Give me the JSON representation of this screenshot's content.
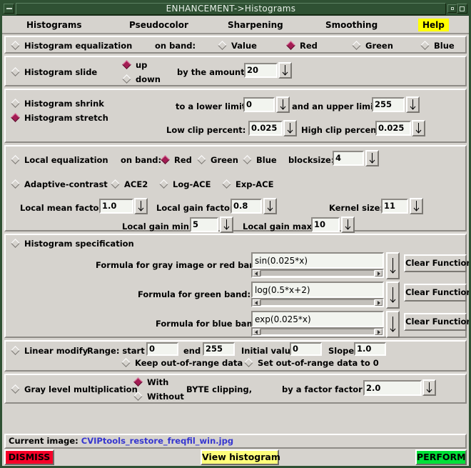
{
  "window": {
    "title": "ENHANCEMENT->Histograms",
    "minimize_icon": "minimize-icon",
    "restore_icon": "restore-icon",
    "maximize_icon": "maximize-icon"
  },
  "menubar": {
    "items": [
      {
        "label": "Histograms"
      },
      {
        "label": "Pseudocolor"
      },
      {
        "label": "Sharpening"
      },
      {
        "label": "Smoothing"
      },
      {
        "label": "Help"
      }
    ]
  },
  "equalization": {
    "title": "Histogram equalization",
    "on_band_label": "on band:",
    "bands": [
      {
        "label": "Value",
        "selected": false
      },
      {
        "label": "Red",
        "selected": true
      },
      {
        "label": "Green",
        "selected": false
      },
      {
        "label": "Blue",
        "selected": false
      }
    ],
    "selected": false
  },
  "slide": {
    "title": "Histogram slide",
    "selected": false,
    "direction_options": [
      {
        "label": "up",
        "selected": true
      },
      {
        "label": "down",
        "selected": false
      }
    ],
    "amount_label": "by the amount:",
    "amount_value": "20"
  },
  "shrink_stretch": {
    "shrink_label": "Histogram shrink",
    "shrink_selected": false,
    "stretch_label": "Histogram stretch",
    "stretch_selected": true,
    "lower_limit_label": "to a lower limit:",
    "lower_limit_value": "0",
    "upper_limit_label": "and an upper limit:",
    "upper_limit_value": "255",
    "low_clip_label": "Low clip percent:",
    "low_clip_value": "0.025",
    "high_clip_label": "High clip percent:",
    "high_clip_value": "0.025"
  },
  "local_eq": {
    "title": "Local equalization",
    "selected": false,
    "on_band_label": "on band:",
    "bands": [
      {
        "label": "Red",
        "selected": true
      },
      {
        "label": "Green",
        "selected": false
      },
      {
        "label": "Blue",
        "selected": false
      }
    ],
    "blocksize_label": "blocksize:",
    "blocksize_value": "4",
    "methods": [
      {
        "label": "Adaptive-contrast",
        "selected": false
      },
      {
        "label": "ACE2",
        "selected": false
      },
      {
        "label": "Log-ACE",
        "selected": false
      },
      {
        "label": "Exp-ACE",
        "selected": false
      }
    ],
    "local_mean_label": "Local mean factor:",
    "local_mean_value": "1.0",
    "local_gain_label": "Local gain factor:",
    "local_gain_value": "0.8",
    "kernel_label": "Kernel size:",
    "kernel_value": "11",
    "gain_min_label": "Local gain min:",
    "gain_min_value": "5",
    "gain_max_label": "Local gain max:",
    "gain_max_value": "10"
  },
  "specification": {
    "title": "Histogram specification",
    "selected": false,
    "rows": [
      {
        "label": "Formula for gray image or red band:",
        "value": "sin(0.025*x)",
        "button": "Clear Function"
      },
      {
        "label": "Formula for green band:",
        "value": "log(0.5*x+2)",
        "button": "Clear Function"
      },
      {
        "label": "Formula for blue band:",
        "value": "exp(0.025*x)",
        "button": "Clear Function"
      }
    ]
  },
  "linear_modify": {
    "title": "Linear modify",
    "selected": false,
    "range_label": "Range: start",
    "start_value": "0",
    "end_label": "end",
    "end_value": "255",
    "initial_label": "Initial value:",
    "initial_value": "0",
    "slope_label": "Slope:",
    "slope_value": "1.0",
    "options": [
      {
        "label": "Keep out-of-range data",
        "selected": true
      },
      {
        "label": "Set out-of-range data to 0",
        "selected": false
      }
    ]
  },
  "gray_mult": {
    "title": "Gray level multiplication",
    "selected": false,
    "clip_options": [
      {
        "label": "With",
        "selected": true
      },
      {
        "label": "Without",
        "selected": false
      }
    ],
    "clip_suffix": "BYTE clipping,",
    "factor_label": "by a factor factor:",
    "factor_value": "2.0"
  },
  "status": {
    "current_image_label": "Current image:",
    "current_image_name": "CVIPtools_restore_freqfil_win.jpg"
  },
  "actions": {
    "dismiss": "DISMISS",
    "view_histogram": "View histogram",
    "perform": "PERFORM"
  },
  "colors": {
    "title_bar": "#2f5133",
    "face": "#d6d3ce",
    "selected_diamond": "#a31c53",
    "help_highlight": "#ffff00",
    "dismiss": "#f50028",
    "view": "#ffff7b",
    "perform": "#00e038",
    "link": "#3535d0"
  }
}
